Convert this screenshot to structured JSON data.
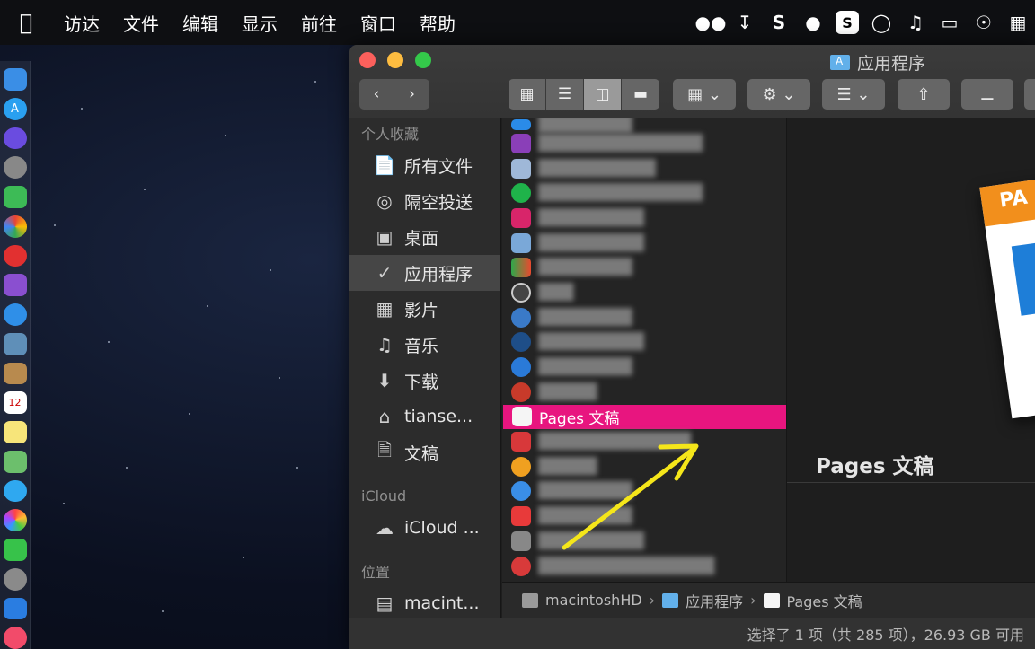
{
  "menubar": {
    "apple_icon": "apple-logo-icon",
    "items": [
      "访达",
      "文件",
      "编辑",
      "显示",
      "前往",
      "窗口",
      "帮助"
    ]
  },
  "window": {
    "title": "应用程序"
  },
  "sidebar": {
    "favorites_header": "个人收藏",
    "favorites": [
      {
        "label": "所有文件",
        "icon": "document-icon"
      },
      {
        "label": "隔空投送",
        "icon": "airdrop-icon"
      },
      {
        "label": "桌面",
        "icon": "desktop-icon"
      },
      {
        "label": "应用程序",
        "icon": "applications-icon",
        "selected": true
      },
      {
        "label": "影片",
        "icon": "film-icon"
      },
      {
        "label": "音乐",
        "icon": "music-note-icon"
      },
      {
        "label": "下载",
        "icon": "download-icon"
      },
      {
        "label": "tianse...",
        "icon": "home-icon"
      },
      {
        "label": "文稿",
        "icon": "documents-icon"
      }
    ],
    "icloud_header": "iCloud",
    "icloud": [
      {
        "label": "iCloud ...",
        "icon": "cloud-icon"
      }
    ],
    "locations_header": "位置",
    "locations": [
      {
        "label": "macint...",
        "icon": "disk-icon"
      }
    ]
  },
  "column": {
    "selected_label": "Pages 文稿"
  },
  "preview": {
    "name": "Pages 文稿",
    "doc_label": "PA"
  },
  "pathbar": {
    "items": [
      "macintoshHD",
      "应用程序",
      "Pages 文稿"
    ]
  },
  "statusbar": {
    "text": "选择了 1 项（共 285 项），26.93 GB 可用"
  },
  "colors": {
    "selection": "#e8157f",
    "annotation_arrow": "#f5e61a",
    "close": "#fc605c",
    "minimize": "#fdbc40",
    "zoom": "#34c84a"
  }
}
